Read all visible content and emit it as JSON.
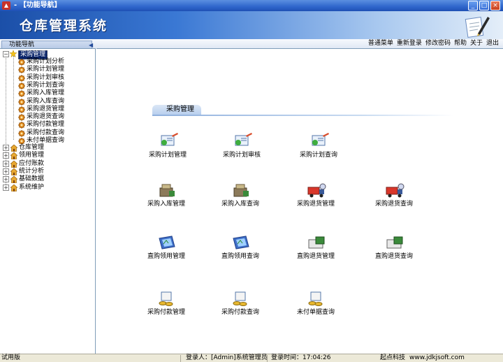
{
  "window": {
    "title": "- 【功能导航】",
    "buttons": [
      "_",
      "□",
      "×"
    ]
  },
  "banner": {
    "system_title": "仓库管理系统"
  },
  "navigation_tab": {
    "label": "功能导航"
  },
  "menu": [
    "普通菜单",
    "重新登录",
    "修改密码",
    "帮助",
    "关于",
    "退出"
  ],
  "tree": {
    "expanded": {
      "label": "采购管理",
      "expander": "−",
      "children": [
        "采购计划分析",
        "采购计划管理",
        "采购计划审核",
        "采购计划查询",
        "采购入库管理",
        "采购入库查询",
        "采购退货管理",
        "采购退货查询",
        "采购付款管理",
        "采购付款查询",
        "未付单据查询"
      ]
    },
    "collapsed": [
      {
        "label": "仓库管理",
        "expander": "+"
      },
      {
        "label": "领用管理",
        "expander": "+"
      },
      {
        "label": "应付账款",
        "expander": "+"
      },
      {
        "label": "统计分析",
        "expander": "+"
      },
      {
        "label": "基础数据",
        "expander": "+"
      },
      {
        "label": "系统维护",
        "expander": "+"
      }
    ]
  },
  "content": {
    "section_title": "采购管理",
    "tiles": [
      {
        "label": "采购计划管理",
        "icon": "plan-icon"
      },
      {
        "label": "采购计划审核",
        "icon": "plan-review-icon"
      },
      {
        "label": "采购计划查询",
        "icon": "plan-query-icon"
      },
      {
        "label": "采购入库管理",
        "icon": "stock-in-icon"
      },
      {
        "label": "采购入库查询",
        "icon": "stock-in-query-icon"
      },
      {
        "label": "采购退货管理",
        "icon": "return-truck-icon"
      },
      {
        "label": "采购退货查询",
        "icon": "return-query-icon"
      },
      {
        "label": "直购领用管理",
        "icon": "direct-use-icon"
      },
      {
        "label": "直购领用查询",
        "icon": "direct-use-query-icon"
      },
      {
        "label": "直购退货管理",
        "icon": "direct-return-icon"
      },
      {
        "label": "直购退货查询",
        "icon": "direct-return-query-icon"
      },
      {
        "label": "采购付款管理",
        "icon": "payment-icon"
      },
      {
        "label": "采购付款查询",
        "icon": "payment-query-icon"
      },
      {
        "label": "未付单据查询",
        "icon": "unpaid-query-icon"
      }
    ]
  },
  "statusbar": {
    "version": "试用版",
    "login_user": "登录人：[Admin]系统管理员",
    "login_time": "登录时间：17:04:26",
    "company": "起点科技",
    "website": "www.jdkjsoft.com"
  },
  "colors": {
    "titlebar": "#2f66cc",
    "selection": "#0a246a",
    "panel_border": "#7f9db9"
  }
}
